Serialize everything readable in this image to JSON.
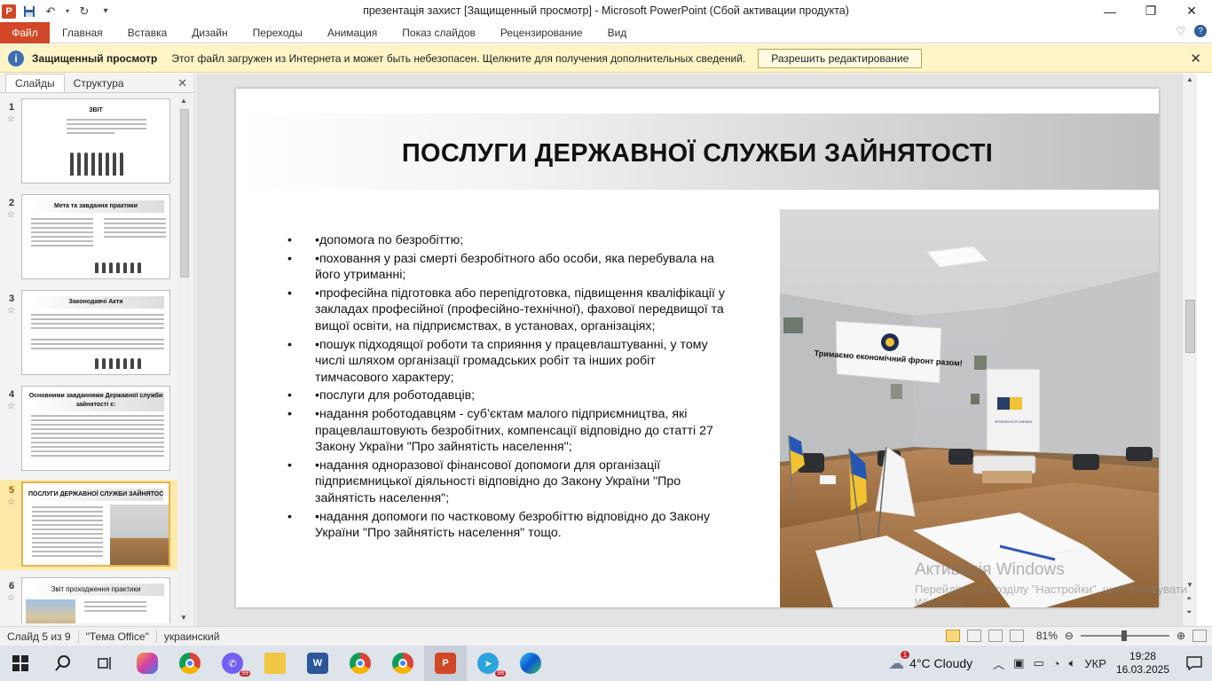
{
  "app": {
    "window_title": "презентація захист [Защищенный просмотр]  -  Microsoft PowerPoint (Сбой активации продукта)",
    "icon_letter": "P"
  },
  "ribbon": {
    "file": "Файл",
    "tabs": [
      "Главная",
      "Вставка",
      "Дизайн",
      "Переходы",
      "Анимация",
      "Показ слайдов",
      "Рецензирование",
      "Вид"
    ]
  },
  "protected_view": {
    "title": "Защищенный просмотр",
    "message": "Этот файл загружен из Интернета и может быть небезопасен. Щелкните для получения дополнительных сведений.",
    "button": "Разрешить редактирование"
  },
  "left_pane": {
    "tabs": [
      "Слайды",
      "Структура"
    ],
    "thumbnails": [
      {
        "num": "1",
        "title": "ЗВІТ"
      },
      {
        "num": "2",
        "title": "Мета та завдання практики"
      },
      {
        "num": "3",
        "title": "Законодавчі Акти"
      },
      {
        "num": "4",
        "title": "Основними завданнями Державної служби зайнятості є:"
      },
      {
        "num": "5",
        "title": "ПОСЛУГИ ДЕРЖАВНОЇ СЛУЖБИ ЗАЙНЯТОСТІ"
      },
      {
        "num": "6",
        "title": "Звіт проходження практики"
      }
    ],
    "selected": "5"
  },
  "slide": {
    "title": "ПОСЛУГИ ДЕРЖАВНОЇ СЛУЖБИ ЗАЙНЯТОСТІ",
    "bullets": [
      "•допомога по безробіттю;",
      "•поховання у разі смерті безробітного або особи, яка перебувала на його утриманні;",
      "•професійна підготовка або перепідготовка, підвищення кваліфікації у закладах професійної (професійно-технічної), фахової передвищої та вищої освіти, на підприємствах, в установах, організаціях;",
      "•пошук підходящої роботи та сприяння у працевлаштуванні, у тому числі шляхом організації громадських робіт та інших робіт тимчасового характеру;",
      "•послуги для роботодавців;",
      "•надання роботодавцям - суб’єктам малого підприємництва, які працевлаштовують безробітних, компенсації відповідно до статті 27 Закону України \"Про зайнятість населення\";",
      "•надання одноразової фінансової допомоги для організації підприємницької діяльності відповідно до Закону України \"Про зайнятість населення\";",
      "•надання допомоги по частковому безробіттю відповідно до Закону України \"Про зайнятість населення\" тощо."
    ],
    "photo_banner": "Тримаємо економічний фронт разом!",
    "photo_rollup": "ЗРОБЛЕНО В УКРАЇНІ"
  },
  "watermark": {
    "line1": "Активація Windows",
    "line2": "Перейдіть до розділу \"Настройки\", щоб активувати Windows."
  },
  "statusbar": {
    "slide_info": "Слайд 5 из 9",
    "theme": "\"Тема Office\"",
    "language": "украинский",
    "zoom": "81%"
  },
  "taskbar": {
    "weather": "4°C  Cloudy",
    "weather_badge": "1",
    "language": "УКР",
    "time": "19:28",
    "date": "16.03.2025",
    "viber_badge": "99",
    "telegram_badge": "98"
  }
}
